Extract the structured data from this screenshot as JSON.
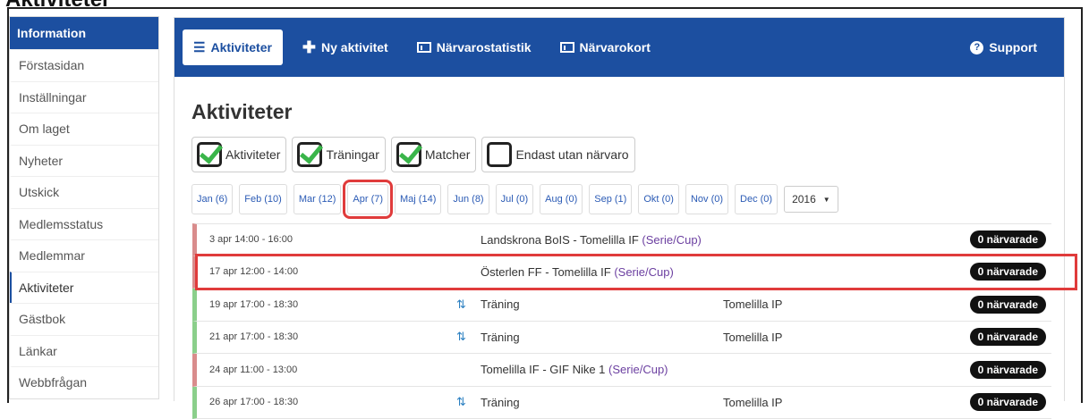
{
  "window": {
    "title": "Aktiviteter"
  },
  "sidebar": {
    "header": "Information",
    "items": [
      {
        "label": "Förstasidan"
      },
      {
        "label": "Inställningar"
      },
      {
        "label": "Om laget"
      },
      {
        "label": "Nyheter"
      },
      {
        "label": "Utskick"
      },
      {
        "label": "Medlemsstatus"
      },
      {
        "label": "Medlemmar"
      },
      {
        "label": "Aktiviteter",
        "active": true
      },
      {
        "label": "Gästbok"
      },
      {
        "label": "Länkar"
      },
      {
        "label": "Webbfrågan"
      }
    ]
  },
  "navbar": {
    "items": [
      {
        "label": "Aktiviteter",
        "icon": "menu-icon"
      },
      {
        "label": "Ny aktivitet",
        "icon": "plus-icon"
      },
      {
        "label": "Närvarostatistik",
        "icon": "chart-icon"
      },
      {
        "label": "Närvarokort",
        "icon": "chart-icon"
      }
    ],
    "support": {
      "label": "Support",
      "icon": "help-icon"
    }
  },
  "page": {
    "title": "Aktiviteter"
  },
  "filters": [
    {
      "label": "Aktiviteter",
      "checked": true
    },
    {
      "label": "Träningar",
      "checked": true
    },
    {
      "label": "Matcher",
      "checked": true
    },
    {
      "label": "Endast utan närvaro",
      "checked": false
    }
  ],
  "months": [
    "Jan (6)",
    "Feb (10)",
    "Mar (12)",
    "Apr (7)",
    "Maj (14)",
    "Jun (8)",
    "Jul (0)",
    "Aug (0)",
    "Sep (1)",
    "Okt (0)",
    "Nov (0)",
    "Dec (0)"
  ],
  "selected_month": "Apr (7)",
  "year": {
    "value": "2016",
    "arrow": "▼"
  },
  "activities": [
    {
      "time": "3 apr 14:00 - 16:00",
      "type": "match",
      "title": "Landskrona BoIS - Tomelilla IF",
      "tag": "(Serie/Cup)",
      "place": "",
      "badge": "0 närvarade"
    },
    {
      "time": "17 apr 12:00 - 14:00",
      "type": "match",
      "title": "Österlen FF - Tomelilla IF",
      "tag": "(Serie/Cup)",
      "place": "",
      "badge": "0 närvarade",
      "highlighted": true
    },
    {
      "time": "19 apr 17:00 - 18:30",
      "type": "training",
      "title": "Träning",
      "tag": "",
      "place": "Tomelilla IP",
      "badge": "0 närvarade"
    },
    {
      "time": "21 apr 17:00 - 18:30",
      "type": "training",
      "title": "Träning",
      "tag": "",
      "place": "Tomelilla IP",
      "badge": "0 närvarade"
    },
    {
      "time": "24 apr 11:00 - 13:00",
      "type": "match",
      "title": "Tomelilla IF - GIF Nike 1",
      "tag": "(Serie/Cup)",
      "place": "",
      "badge": "0 närvarade"
    },
    {
      "time": "26 apr 17:00 - 18:30",
      "type": "training",
      "title": "Träning",
      "tag": "",
      "place": "Tomelilla IP",
      "badge": "0 närvarade"
    }
  ],
  "colors": {
    "brand": "#1c4fa0",
    "highlight": "#e03b3b",
    "check": "#3ab54a",
    "match_bar": "#d98c8c",
    "training_bar": "#8bcf8b"
  }
}
